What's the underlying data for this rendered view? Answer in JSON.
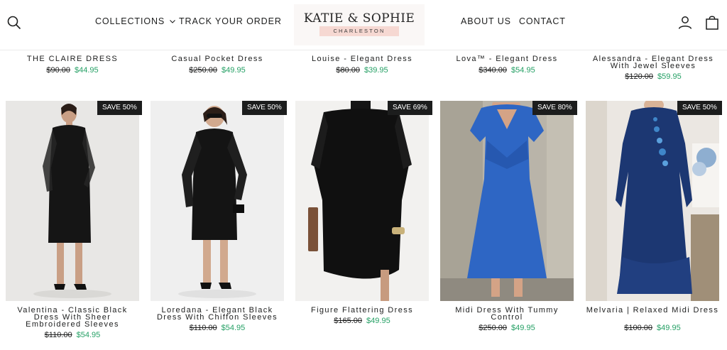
{
  "header": {
    "nav_left": [
      {
        "label": "COLLECTIONS"
      },
      {
        "label": "TRACK YOUR ORDER"
      }
    ],
    "nav_right": [
      {
        "label": "ABOUT US"
      },
      {
        "label": "CONTACT"
      }
    ],
    "logo": {
      "name": "KATIE & SOPHIE",
      "subtitle": "CHARLESTON"
    }
  },
  "top_row": [
    {
      "title": "THE CLAIRE DRESS",
      "old_price": "$90.00",
      "price": "$44.95"
    },
    {
      "title": "Casual Pocket Dress",
      "old_price": "$250.00",
      "price": "$49.95"
    },
    {
      "title": "Louise - Elegant Dress",
      "old_price": "$80.00",
      "price": "$39.95"
    },
    {
      "title": "Lova™ - Elegant Dress",
      "old_price": "$340.00",
      "price": "$54.95"
    },
    {
      "title": "Alessandra - Elegant Dress With Jewel Sleeves",
      "old_price": "$120.00",
      "price": "$59.95"
    }
  ],
  "products": [
    {
      "badge": "SAVE 50%",
      "title": "Valentina - Classic Black Dress With Sheer Embroidered Sleeves",
      "old_price": "$110.00",
      "price": "$54.95",
      "image": "black-sheer-sleeve-dress-photo"
    },
    {
      "badge": "SAVE 50%",
      "title": "Loredana - Elegant Black Dress With Chiffon Sleeves",
      "old_price": "$110.00",
      "price": "$54.95",
      "image": "black-chiffon-sleeve-dress-photo"
    },
    {
      "badge": "SAVE 69%",
      "title": "Figure Flattering Dress",
      "old_price": "$165.00",
      "price": "$49.95",
      "image": "black-draped-dress-photo"
    },
    {
      "badge": "SAVE 80%",
      "title": "Midi Dress With Tummy Control",
      "old_price": "$250.00",
      "price": "$49.95",
      "image": "blue-midi-dress-photo"
    },
    {
      "badge": "SAVE 50%",
      "title": "Melvaria | Relaxed Midi Dress",
      "old_price": "$100.00",
      "price": "$49.95",
      "image": "navy-relaxed-midi-dress-photo"
    }
  ],
  "colors": {
    "sale_price": "#25a065",
    "badge_bg": "#1c1d1d",
    "text": "#1c1d1d",
    "logo_band": "#f6d8d2"
  }
}
